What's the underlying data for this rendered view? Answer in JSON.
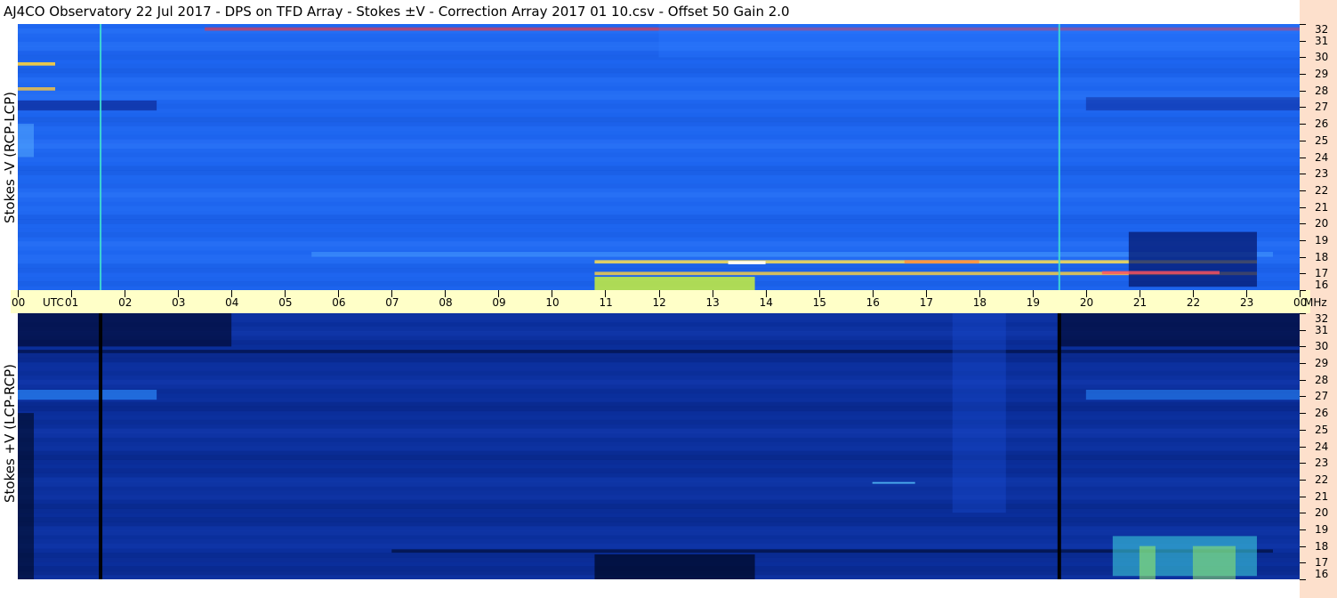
{
  "title": "AJ4CO Observatory  22 Jul 2017  -  DPS on TFD Array  -  Stokes ±V  -  Correction Array 2017 01 10.csv  -  Offset 50  Gain 2.0",
  "panels": {
    "top_label": "Stokes -V (RCP-LCP)",
    "bottom_label": "Stokes +V (LCP-RCP)"
  },
  "time_axis": {
    "labels": [
      "00",
      "01",
      "02",
      "03",
      "04",
      "05",
      "06",
      "07",
      "08",
      "09",
      "10",
      "11",
      "12",
      "13",
      "14",
      "15",
      "16",
      "17",
      "18",
      "19",
      "20",
      "21",
      "22",
      "23",
      "00"
    ],
    "utc_label": "UTC",
    "freq_unit": "MHz"
  },
  "chart_data": {
    "type": "heatmap",
    "title": "AJ4CO Observatory  22 Jul 2017  -  DPS on TFD Array  -  Stokes ±V  -  Correction Array 2017 01 10.csv  -  Offset 50  Gain 2.0",
    "x_unit": "UTC hour",
    "x_range": [
      0,
      24
    ],
    "y_unit": "MHz",
    "y_range": [
      16,
      32
    ],
    "y_ticks": [
      16,
      17,
      18,
      19,
      20,
      21,
      22,
      23,
      24,
      25,
      26,
      27,
      28,
      29,
      30,
      31,
      32
    ],
    "colors": {
      "top_background": "#1e66f0",
      "bottom_background": "#0b2f9c",
      "time_bar": "#ffffc8",
      "right_strip": "#fde0cc",
      "marker_top": "#40e0d0",
      "marker_bottom": "#000000"
    },
    "marker_hours": [
      1.55,
      19.5
    ],
    "features": [
      {
        "panel": "top",
        "t0": 0.0,
        "t1": 2.6,
        "f0": 26.8,
        "f1": 27.4,
        "color": "#0a1a80",
        "opacity": 0.55
      },
      {
        "panel": "top",
        "t0": 0.0,
        "t1": 0.7,
        "f0": 29.5,
        "f1": 29.7,
        "color": "#ffd23c",
        "opacity": 0.9
      },
      {
        "panel": "top",
        "t0": 0.0,
        "t1": 0.7,
        "f0": 28.0,
        "f1": 28.2,
        "color": "#ffc83c",
        "opacity": 0.8
      },
      {
        "panel": "top",
        "t0": 0.0,
        "t1": 0.3,
        "f0": 24.0,
        "f1": 26.0,
        "color": "#5ab0ff",
        "opacity": 0.5
      },
      {
        "panel": "top",
        "t0": 10.8,
        "t1": 13.8,
        "f0": 16.0,
        "f1": 16.8,
        "color": "#c8f03c",
        "opacity": 0.85
      },
      {
        "panel": "top",
        "t0": 10.8,
        "t1": 23.2,
        "f0": 17.6,
        "f1": 17.8,
        "color": "#ffe050",
        "opacity": 0.85
      },
      {
        "panel": "top",
        "t0": 10.8,
        "t1": 23.2,
        "f0": 16.9,
        "f1": 17.1,
        "color": "#ffd23c",
        "opacity": 0.8
      },
      {
        "panel": "top",
        "t0": 5.5,
        "t1": 23.5,
        "f0": 18.0,
        "f1": 18.3,
        "color": "#4aa0ff",
        "opacity": 0.5
      },
      {
        "panel": "top",
        "t0": 20.8,
        "t1": 23.2,
        "f0": 16.2,
        "f1": 19.5,
        "color": "#061a70",
        "opacity": 0.75
      },
      {
        "panel": "top",
        "t0": 13.3,
        "t1": 14.0,
        "f0": 17.55,
        "f1": 17.75,
        "color": "#ffffff",
        "opacity": 0.9
      },
      {
        "panel": "top",
        "t0": 16.6,
        "t1": 18.0,
        "f0": 17.6,
        "f1": 17.8,
        "color": "#ff9040",
        "opacity": 0.9
      },
      {
        "panel": "top",
        "t0": 20.3,
        "t1": 22.5,
        "f0": 16.95,
        "f1": 17.15,
        "color": "#ff5060",
        "opacity": 0.8
      },
      {
        "panel": "top",
        "t0": 20.0,
        "t1": 24.0,
        "f0": 26.8,
        "f1": 27.6,
        "color": "#0a1a80",
        "opacity": 0.4
      },
      {
        "panel": "top",
        "t0": 3.5,
        "t1": 24.0,
        "f0": 31.6,
        "f1": 31.8,
        "color": "#ff3030",
        "opacity": 0.6
      },
      {
        "panel": "top",
        "t0": 12.0,
        "t1": 24.0,
        "f0": 30.0,
        "f1": 32.0,
        "color": "#2a78ff",
        "opacity": 0.35
      },
      {
        "panel": "bottom",
        "t0": 0.0,
        "t1": 4.0,
        "f0": 30.0,
        "f1": 32.0,
        "color": "#030d3c",
        "opacity": 0.75
      },
      {
        "panel": "bottom",
        "t0": 19.5,
        "t1": 24.0,
        "f0": 30.0,
        "f1": 32.0,
        "color": "#030d3c",
        "opacity": 0.75
      },
      {
        "panel": "bottom",
        "t0": 0.0,
        "t1": 24.0,
        "f0": 29.6,
        "f1": 29.8,
        "color": "#000a30",
        "opacity": 0.6
      },
      {
        "panel": "bottom",
        "t0": 0.0,
        "t1": 2.6,
        "f0": 26.8,
        "f1": 27.4,
        "color": "#2c8cff",
        "opacity": 0.65
      },
      {
        "panel": "bottom",
        "t0": 20.0,
        "t1": 24.0,
        "f0": 26.8,
        "f1": 27.4,
        "color": "#2c8cff",
        "opacity": 0.55
      },
      {
        "panel": "bottom",
        "t0": 0.0,
        "t1": 0.3,
        "f0": 16.0,
        "f1": 26.0,
        "color": "#000820",
        "opacity": 0.6
      },
      {
        "panel": "bottom",
        "t0": 10.8,
        "t1": 13.8,
        "f0": 16.0,
        "f1": 17.5,
        "color": "#000a28",
        "opacity": 0.75
      },
      {
        "panel": "bottom",
        "t0": 7.0,
        "t1": 23.5,
        "f0": 17.6,
        "f1": 17.8,
        "color": "#000a28",
        "opacity": 0.6
      },
      {
        "panel": "bottom",
        "t0": 20.5,
        "t1": 23.2,
        "f0": 16.2,
        "f1": 18.6,
        "color": "#3fd8e0",
        "opacity": 0.55
      },
      {
        "panel": "bottom",
        "t0": 21.0,
        "t1": 21.3,
        "f0": 16.0,
        "f1": 18.0,
        "color": "#9cf060",
        "opacity": 0.55
      },
      {
        "panel": "bottom",
        "t0": 22.0,
        "t1": 22.8,
        "f0": 16.0,
        "f1": 18.0,
        "color": "#9cf060",
        "opacity": 0.5
      },
      {
        "panel": "bottom",
        "t0": 16.0,
        "t1": 16.8,
        "f0": 21.75,
        "f1": 21.85,
        "color": "#5ac8ff",
        "opacity": 0.8
      },
      {
        "panel": "bottom",
        "t0": 17.5,
        "t1": 18.5,
        "f0": 20.0,
        "f1": 32.0,
        "color": "#1a4cd8",
        "opacity": 0.35
      }
    ]
  }
}
